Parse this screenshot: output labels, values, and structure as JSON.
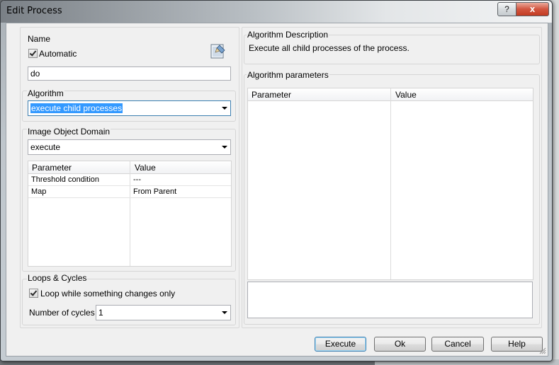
{
  "window": {
    "title": "Edit Process",
    "help_glyph": "?",
    "close_glyph": "x"
  },
  "name_group": {
    "label": "Name",
    "automatic_label": "Automatic",
    "automatic_checked": true,
    "name_value": "do",
    "edit_icon": "edit-name-icon"
  },
  "algorithm": {
    "label": "Algorithm",
    "selected": "execute child processes"
  },
  "domain": {
    "label": "Image Object Domain",
    "selected": "execute",
    "headers": [
      "Parameter",
      "Value"
    ],
    "rows": [
      {
        "param": "Threshold condition",
        "value": "---"
      },
      {
        "param": "Map",
        "value": "From Parent"
      }
    ]
  },
  "loops": {
    "label": "Loops & Cycles",
    "loop_label": "Loop while something changes only",
    "loop_checked": true,
    "cycles_label": "Number of cycles",
    "cycles_value": "1"
  },
  "description": {
    "label": "Algorithm Description",
    "text": "Execute all child processes of the process."
  },
  "parameters": {
    "label": "Algorithm parameters",
    "headers": [
      "Parameter",
      "Value"
    ]
  },
  "buttons": {
    "execute": "Execute",
    "ok": "Ok",
    "cancel": "Cancel",
    "help": "Help"
  },
  "colors": {
    "selection": "#3399ff",
    "close_button": "#c23b22"
  }
}
